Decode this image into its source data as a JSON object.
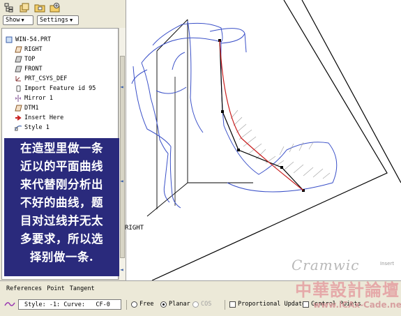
{
  "toolbar": {
    "icons": [
      "model-tree-icon",
      "layers-icon",
      "folder-icon",
      "settings-icon"
    ],
    "show_label": "Show",
    "settings_label": "Settings"
  },
  "model_tree": {
    "items": [
      {
        "label": "WIN-54.PRT",
        "icon": "part-icon"
      },
      {
        "label": "RIGHT",
        "icon": "datum-plane-icon"
      },
      {
        "label": "TOP",
        "icon": "datum-plane-icon"
      },
      {
        "label": "FRONT",
        "icon": "datum-plane-icon"
      },
      {
        "label": "PRT_CSYS_DEF",
        "icon": "csys-icon"
      },
      {
        "label": "Import Feature id 95",
        "icon": "import-icon"
      },
      {
        "label": "Mirror 1",
        "icon": "mirror-icon"
      },
      {
        "label": "DTM1",
        "icon": "datum-plane-icon"
      },
      {
        "label": "Insert Here",
        "icon": "insert-arrow-icon"
      },
      {
        "label": "Style 1",
        "icon": "style-icon"
      }
    ]
  },
  "annotation": {
    "lines": [
      "在造型里做一条",
      "近以的平面曲线",
      "来代替刚分析出",
      "不好的曲线，题",
      "目对过线并无太",
      "多要求，所以选",
      "择别做一条."
    ]
  },
  "graphics": {
    "datum_label": "RIGHT",
    "watermark_script": "Cramwic",
    "corner_text": "Insert"
  },
  "dashboard": {
    "tabs": [
      "References",
      "Point",
      "Tangent"
    ],
    "style_field": "Style: -1: Curve:   CF-0",
    "options": {
      "free": "Free",
      "planar": "Planar",
      "cos": "COS",
      "proportional_update": "Proportional Update",
      "control_points": "Control Points"
    },
    "selected_type": "Planar"
  },
  "watermark": {
    "title": "中華設計論壇",
    "url": "www.iCAx-Cade.net"
  },
  "colors": {
    "curve_blue": "#3a50c8",
    "selected_curve_red": "#c81e1e",
    "annotation_bg": "#2a2a7c"
  }
}
